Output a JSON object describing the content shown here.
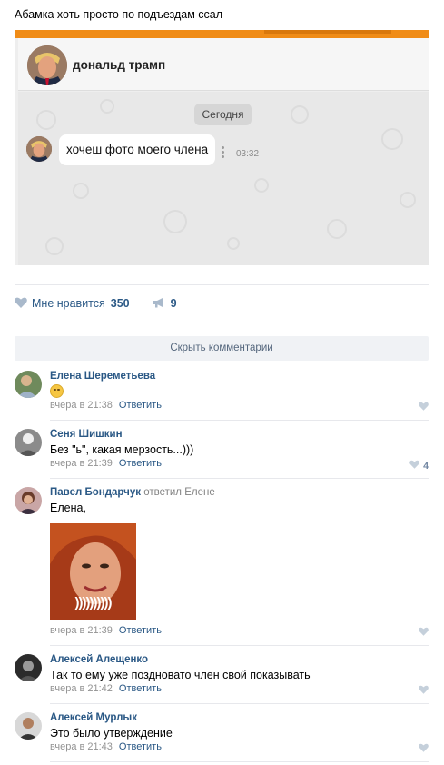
{
  "post": {
    "text": "Абамка хоть просто по подъездам ссал"
  },
  "screenshot": {
    "contact_name": "дональд трамп",
    "date_badge": "Сегодня",
    "message_text": "хочеш фото моего члена",
    "message_time": "03:32",
    "accent_color": "#f08c17"
  },
  "actions": {
    "like_label": "Мне нравится",
    "like_count": "350",
    "share_count": "9",
    "like_icon": "heart-icon",
    "share_icon": "megaphone-icon"
  },
  "comments_toggle": {
    "label": "Скрыть комментарии"
  },
  "comments": [
    {
      "author": "Елена Шереметьева",
      "replied_to": "",
      "text": "",
      "emoji": "smiling-face-emoji",
      "time": "вчера в 21:38",
      "reply_label": "Ответить",
      "likes": ""
    },
    {
      "author": "Сеня Шишкин",
      "replied_to": "",
      "text": "Без \"ь\", какая мерзость...)))",
      "time": "вчера в 21:39",
      "reply_label": "Ответить",
      "likes": "4"
    },
    {
      "author": "Павел Бондарчук",
      "replied_to": "ответил Елене",
      "text": "Елена,",
      "photo_caption": "))))))))))",
      "time": "вчера в 21:39",
      "reply_label": "Ответить",
      "likes": ""
    },
    {
      "author": "Алексей Алещенко",
      "replied_to": "",
      "text": "Так то ему уже поздновато член свой показывать",
      "time": "вчера в 21:42",
      "reply_label": "Ответить",
      "likes": ""
    },
    {
      "author": "Алексей Мурлык",
      "replied_to": "",
      "text": "Это было утверждение",
      "time": "вчера в 21:43",
      "reply_label": "Ответить",
      "likes": ""
    }
  ]
}
